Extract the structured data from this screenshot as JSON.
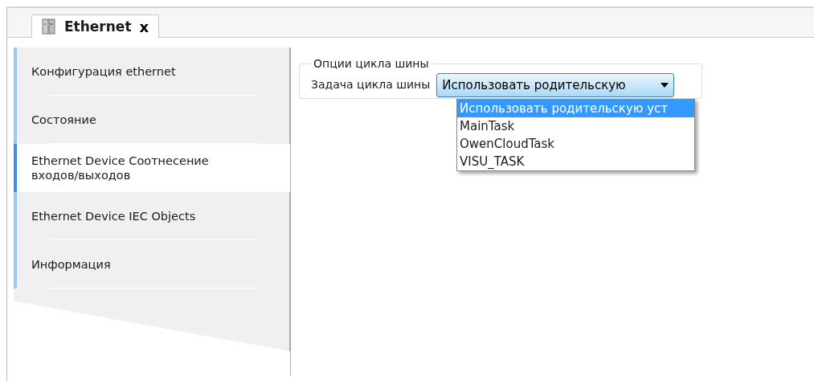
{
  "tab": {
    "label": "Ethernet",
    "close": "x"
  },
  "sidebar": {
    "items": [
      {
        "label": "Конфигурация ethernet",
        "selected": false
      },
      {
        "label": "Состояние",
        "selected": false
      },
      {
        "label": "Ethernet Device Соотнесение входов/выходов",
        "selected": true
      },
      {
        "label": "Ethernet Device IEC Objects",
        "selected": false
      },
      {
        "label": "Информация",
        "selected": false
      }
    ]
  },
  "group": {
    "title": "Опции цикла шины",
    "field_label": "Задача цикла шины",
    "dropdown": {
      "value": "Использовать родительскую",
      "expanded": true,
      "options": [
        {
          "label": "Использовать родительскую уст",
          "selected": true
        },
        {
          "label": "MainTask",
          "selected": false
        },
        {
          "label": "OwenCloudTask",
          "selected": false
        },
        {
          "label": "VISU_TASK",
          "selected": false
        }
      ]
    }
  }
}
